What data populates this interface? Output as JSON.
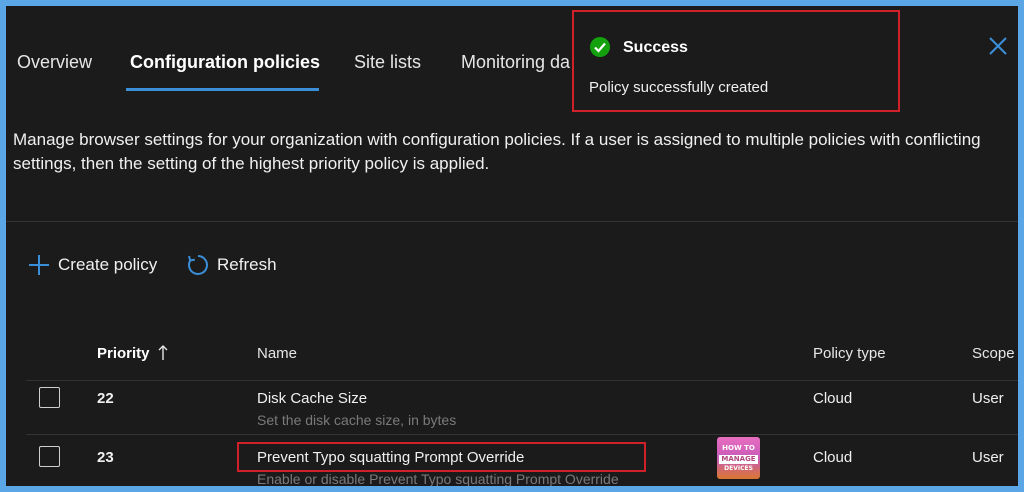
{
  "tabs": [
    {
      "label": "Overview"
    },
    {
      "label": "Configuration policies"
    },
    {
      "label": "Site lists"
    },
    {
      "label": "Monitoring da"
    }
  ],
  "active_tab": "Configuration policies",
  "toast": {
    "title": "Success",
    "message": "Policy successfully created",
    "status_color": "#13a10e"
  },
  "description": "Manage browser settings for your organization with configuration policies. If a user is assigned to multiple policies with conflicting settings, then the setting of the highest priority policy is applied.",
  "commands": {
    "create_label": "Create policy",
    "refresh_label": "Refresh",
    "icons": [
      "plus-icon",
      "refresh-icon"
    ]
  },
  "table": {
    "headers": {
      "priority": "Priority",
      "name": "Name",
      "policy_type": "Policy type",
      "scope": "Scope"
    },
    "sort_icon": "arrow-up-icon",
    "rows": [
      {
        "priority": "22",
        "name": "Disk Cache Size",
        "description": "Set the disk cache size, in bytes",
        "policy_type": "Cloud",
        "scope": "User"
      },
      {
        "priority": "23",
        "name": "Prevent Typo squatting Prompt Override",
        "description": "Enable or disable Prevent Typo squatting Prompt Override",
        "policy_type": "Cloud",
        "scope": "User"
      }
    ]
  },
  "watermark": {
    "line1": "HOW TO",
    "line2": "MANAGE",
    "line3": "DEVICES"
  },
  "colors": {
    "accent": "#3b8fd8",
    "highlight": "#d0202a",
    "background": "#1b1b1b"
  }
}
